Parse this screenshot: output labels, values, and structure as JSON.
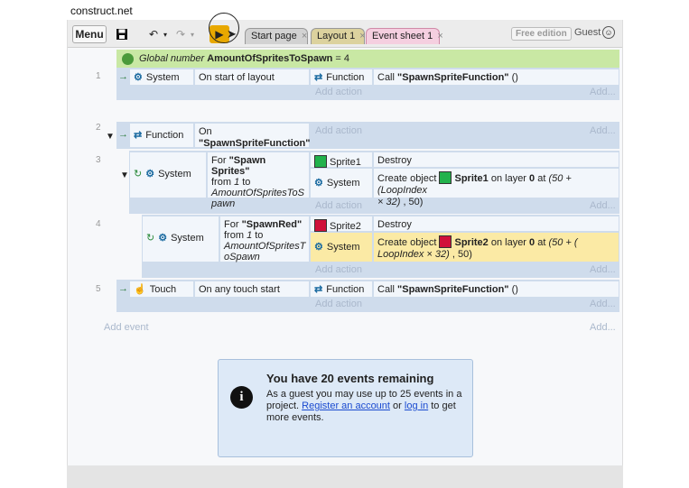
{
  "url": "construct.net",
  "toolbar": {
    "menu": "Menu",
    "save": "save-icon",
    "undo": "↶",
    "redo": "↷",
    "caret": "▾",
    "play": "▶",
    "cursor": "➤",
    "tabs": [
      {
        "label": "Start page",
        "close": "×"
      },
      {
        "label": "Layout 1",
        "close": "×"
      },
      {
        "label": "Event sheet 1",
        "close": "×"
      }
    ],
    "free": "Free edition",
    "guest": "Guest",
    "guest_icon": "☺"
  },
  "global": {
    "prefix": "Global number",
    "name": "AmountOfSpritesToSpawn",
    "value": "= 4"
  },
  "events": [
    {
      "num": "1",
      "obj": "System",
      "cond": "On start of layout",
      "action_obj": "Function",
      "action": "Call ",
      "action_b": "\"SpawnSpriteFunction\"",
      "action_tail": " ()",
      "add_action": "Add action",
      "dots": "Add..."
    },
    {
      "num": "2",
      "obj": "Function",
      "cond_a": "On",
      "cond_b": "\"SpawnSpriteFunction\"",
      "add_action": "Add action",
      "dots": "Add..."
    },
    {
      "num": "3",
      "obj": "System",
      "cond_a": "For ",
      "cond_b": "\"Spawn Sprites\"",
      "cond_c": "from ",
      "cond_d": "1",
      "cond_e": " to",
      "cond_f": "AmountOfSpritesToS",
      "cond_g": "pawn",
      "a1_obj": "Sprite1",
      "a1": "Destroy",
      "a2_obj": "System",
      "a2_a": "Create object ",
      "a2_b": "Sprite1",
      "a2_c": " on layer ",
      "a2_d": "0",
      "a2_e": " at ",
      "a2_f": "(50 + (LoopIndex",
      "a2_g": "× 32)",
      "a2_h": " , 50)",
      "add_action": "Add action",
      "dots": "Add..."
    },
    {
      "num": "4",
      "obj": "System",
      "cond_a": "For ",
      "cond_b": "\"SpawnRed\"",
      "cond_c": "from ",
      "cond_d": "1",
      "cond_e": " to",
      "cond_f": "AmountOfSpritesT",
      "cond_g": "oSpawn",
      "a1_obj": "Sprite2",
      "a1": "Destroy",
      "a2_obj": "System",
      "a2_a": "Create object ",
      "a2_b": "Sprite2",
      "a2_c": " on layer ",
      "a2_d": "0",
      "a2_e": " at ",
      "a2_f": "(50 + (",
      "a2_g": "LoopIndex × 32)",
      "a2_h": " , 50)",
      "add_action": "Add action",
      "dots": "Add..."
    },
    {
      "num": "5",
      "obj": "Touch",
      "cond": "On any touch start",
      "action_obj": "Function",
      "action": "Call ",
      "action_b": "\"SpawnSpriteFunction\"",
      "action_tail": " ()",
      "add_action": "Add action",
      "dots": "Add..."
    }
  ],
  "add_event": "Add event",
  "add_event_dots": "Add...",
  "note": {
    "icon": "i",
    "title": "You have 20 events remaining",
    "body_a": "As a guest you may use up to 25 events in a project. ",
    "link1": "Register an account",
    "body_b": " or ",
    "link2": "log in",
    "body_c": " to get more events."
  },
  "colors": {
    "green_sprite": "#22b24c",
    "red_sprite": "#d0103a",
    "accent": "#e8a800"
  }
}
